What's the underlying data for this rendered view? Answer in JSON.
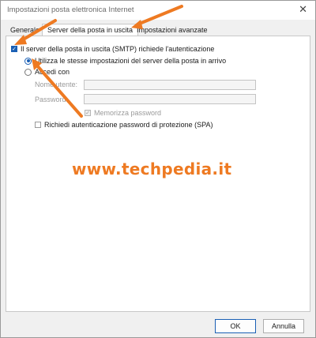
{
  "window": {
    "title": "Impostazioni posta elettronica Internet",
    "close_glyph": "✕"
  },
  "tabs": [
    {
      "label": "Generale"
    },
    {
      "label": "Server della posta in uscita",
      "active": true
    },
    {
      "label": "Impostazioni avanzate"
    }
  ],
  "outgoing": {
    "smtp_auth_label": "Il server della posta in uscita (SMTP) richiede l'autenticazione",
    "smtp_auth_checked": true,
    "use_same_label": "Utilizza le stesse impostazioni del server della posta in arrivo",
    "use_same_selected": true,
    "login_with_label": "Accedi con",
    "username_label": "Nome utente:",
    "username_value": "",
    "password_label": "Password:",
    "password_value": "",
    "remember_password_label": "Memorizza password",
    "remember_password_checked": true,
    "spa_label": "Richiedi autenticazione password di protezione (SPA)",
    "spa_checked": false
  },
  "watermark": "www.techpedia.it",
  "buttons": {
    "ok": "OK",
    "cancel": "Annulla"
  },
  "colors": {
    "accent": "#1a5fb4",
    "annotation_arrow": "#ee7a22"
  }
}
